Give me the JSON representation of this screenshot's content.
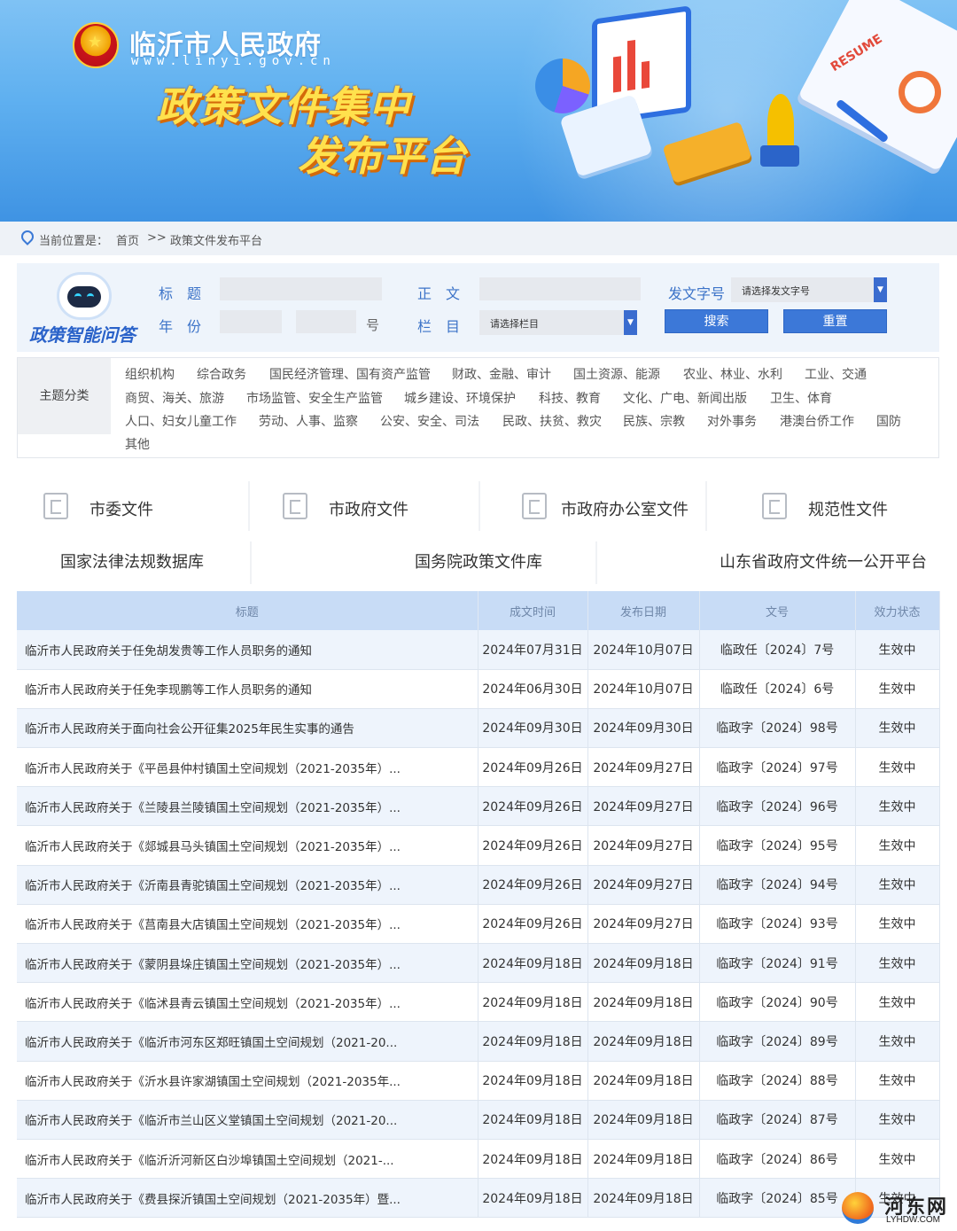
{
  "header": {
    "gov_name": "临沂市人民政府",
    "gov_url": "www.linyi.gov.cn",
    "title_line1": "政策文件集中",
    "title_line2": "发布平台",
    "illustration_text": "RESUME"
  },
  "breadcrumb": {
    "label": "当前位置是：",
    "home": "首页",
    "separator": ">>",
    "current": "政策文件发布平台"
  },
  "search": {
    "ai_label": "政策智能问答",
    "title_label": "标题",
    "body_label": "正文",
    "year_label": "年份",
    "hao_label": "号",
    "column_label": "栏目",
    "column_placeholder": "请选择栏目",
    "doc_no_label": "发文字号",
    "doc_no_placeholder": "请选择发文字号",
    "search_btn": "搜索",
    "reset_btn": "重置",
    "dropdown_arrow": "▼"
  },
  "categories": {
    "head": "主题分类",
    "rows": [
      [
        "组织机构",
        "综合政务",
        "国民经济管理、国有资产监管",
        "财政、金融、审计",
        "国土资源、能源",
        "农业、林业、水利",
        "工业、交通"
      ],
      [
        "商贸、海关、旅游",
        "市场监管、安全生产监管",
        "城乡建设、环境保护",
        "科技、教育",
        "文化、广电、新闻出版",
        "卫生、体育"
      ],
      [
        "人口、妇女儿童工作",
        "劳动、人事、监察",
        "公安、安全、司法",
        "民政、扶贫、救灾",
        "民族、宗教",
        "对外事务",
        "港澳台侨工作",
        "国防"
      ],
      [
        "其他"
      ]
    ]
  },
  "doc_tabs": [
    {
      "label": "市委文件",
      "icon": "document-icon"
    },
    {
      "label": "市政府文件",
      "icon": "document-icon"
    },
    {
      "label": "市政府办公室文件",
      "icon": "book-icon"
    },
    {
      "label": "规范性文件",
      "icon": "form-icon"
    }
  ],
  "db_links": [
    "国家法律法规数据库",
    "国务院政策文件库",
    "山东省政府文件统一公开平台"
  ],
  "table": {
    "headers": [
      "标题",
      "成文时间",
      "发布日期",
      "文号",
      "效力状态"
    ],
    "rows": [
      [
        "临沂市人民政府关于任免胡发贵等工作人员职务的通知",
        "2024年07月31日",
        "2024年10月07日",
        "临政任〔2024〕7号",
        "生效中"
      ],
      [
        "临沂市人民政府关于任免李现鹏等工作人员职务的通知",
        "2024年06月30日",
        "2024年10月07日",
        "临政任〔2024〕6号",
        "生效中"
      ],
      [
        "临沂市人民政府关于面向社会公开征集2025年民生实事的通告",
        "2024年09月30日",
        "2024年09月30日",
        "临政字〔2024〕98号",
        "生效中"
      ],
      [
        "临沂市人民政府关于《平邑县仲村镇国土空间规划（2021-2035年）...",
        "2024年09月26日",
        "2024年09月27日",
        "临政字〔2024〕97号",
        "生效中"
      ],
      [
        "临沂市人民政府关于《兰陵县兰陵镇国土空间规划（2021-2035年）...",
        "2024年09月26日",
        "2024年09月27日",
        "临政字〔2024〕96号",
        "生效中"
      ],
      [
        "临沂市人民政府关于《郯城县马头镇国土空间规划（2021-2035年）...",
        "2024年09月26日",
        "2024年09月27日",
        "临政字〔2024〕95号",
        "生效中"
      ],
      [
        "临沂市人民政府关于《沂南县青驼镇国土空间规划（2021-2035年）...",
        "2024年09月26日",
        "2024年09月27日",
        "临政字〔2024〕94号",
        "生效中"
      ],
      [
        "临沂市人民政府关于《莒南县大店镇国土空间规划（2021-2035年）...",
        "2024年09月26日",
        "2024年09月27日",
        "临政字〔2024〕93号",
        "生效中"
      ],
      [
        "临沂市人民政府关于《蒙阴县垛庄镇国土空间规划（2021-2035年）...",
        "2024年09月18日",
        "2024年09月18日",
        "临政字〔2024〕91号",
        "生效中"
      ],
      [
        "临沂市人民政府关于《临沭县青云镇国土空间规划（2021-2035年）...",
        "2024年09月18日",
        "2024年09月18日",
        "临政字〔2024〕90号",
        "生效中"
      ],
      [
        "临沂市人民政府关于《临沂市河东区郑旺镇国土空间规划（2021-20...",
        "2024年09月18日",
        "2024年09月18日",
        "临政字〔2024〕89号",
        "生效中"
      ],
      [
        "临沂市人民政府关于《沂水县许家湖镇国土空间规划（2021-2035年...",
        "2024年09月18日",
        "2024年09月18日",
        "临政字〔2024〕88号",
        "生效中"
      ],
      [
        "临沂市人民政府关于《临沂市兰山区义堂镇国土空间规划（2021-20...",
        "2024年09月18日",
        "2024年09月18日",
        "临政字〔2024〕87号",
        "生效中"
      ],
      [
        "临沂市人民政府关于《临沂沂河新区白沙埠镇国土空间规划（2021-...",
        "2024年09月18日",
        "2024年09月18日",
        "临政字〔2024〕86号",
        "生效中"
      ],
      [
        "临沂市人民政府关于《费县探沂镇国土空间规划（2021-2035年）暨...",
        "2024年09月18日",
        "2024年09月18日",
        "临政字〔2024〕85号",
        "生效中"
      ]
    ]
  },
  "watermark": {
    "name": "河东网",
    "url": "LYHDW.COM"
  },
  "colors": {
    "accent": "#3c78d8",
    "label_blue": "#3c73c8",
    "table_header": "#c8dcf6",
    "row_stripe": "#eef4fc"
  }
}
